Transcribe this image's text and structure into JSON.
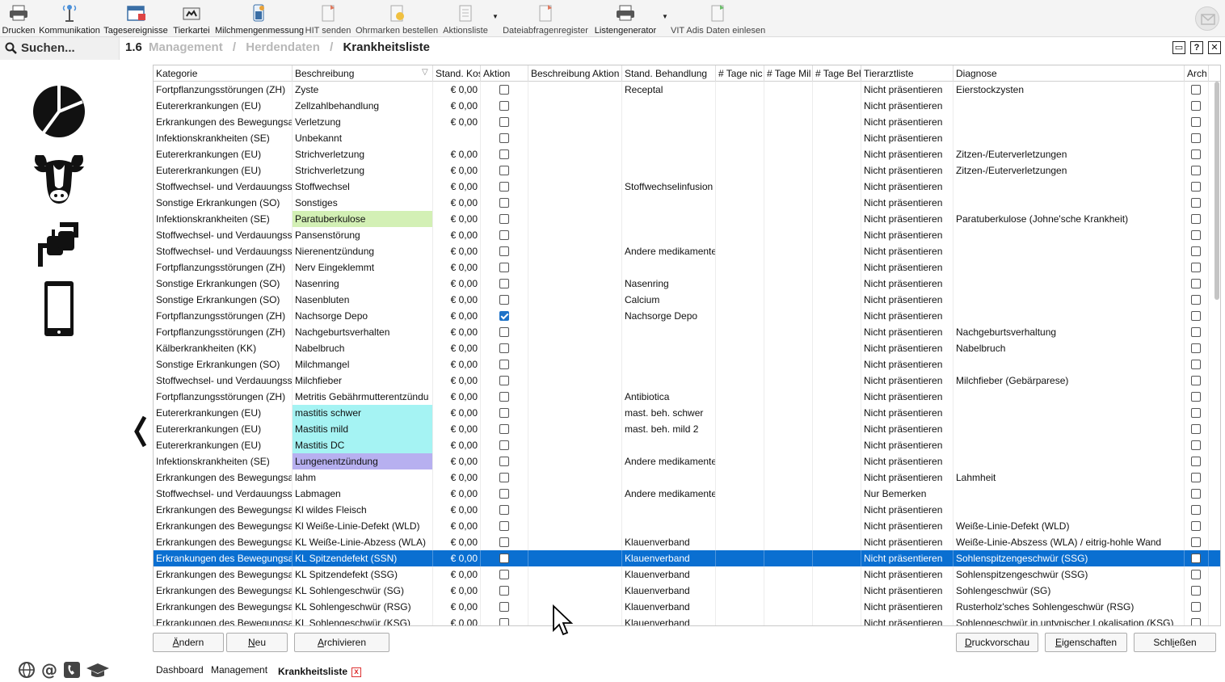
{
  "toolbar": {
    "items": [
      {
        "label": "Drucken",
        "icon": "printer-icon"
      },
      {
        "label": "Kommunikation",
        "icon": "antenna-icon"
      },
      {
        "label": "Tagesereignisse",
        "icon": "calendar-icon"
      },
      {
        "label": "Tierkartei",
        "icon": "card-file-icon"
      },
      {
        "label": "Milchmengenmessung",
        "icon": "milk-measure-icon"
      },
      {
        "label": "HIT senden",
        "icon": "document-send-icon"
      },
      {
        "label": "Ohrmarken bestellen",
        "icon": "ear-tag-order-icon"
      },
      {
        "label": "Aktionsliste",
        "icon": "list-document-icon"
      },
      {
        "label": "Dateiabfragenregister",
        "icon": "document-query-icon"
      },
      {
        "label": "Listengenerator",
        "icon": "printer-list-icon"
      },
      {
        "label": "VIT Adis Daten einlesen",
        "icon": "document-import-icon"
      }
    ]
  },
  "search": {
    "label": "Suchen..."
  },
  "breadcrumb": {
    "number": "1.6",
    "items": [
      "Management",
      "Herdendaten"
    ],
    "current": "Krankheitsliste"
  },
  "window_buttons": {
    "restore": "▭",
    "help": "?",
    "close": "✕"
  },
  "grid": {
    "columns": [
      "Kategorie",
      "Beschreibung",
      "Stand. Kos",
      "Aktion",
      "Beschreibung Aktion",
      "Stand. Behandlung",
      "# Tage nic",
      "# Tage Mil",
      "# Tage Beh",
      "Tierarztliste",
      "Diagnose",
      "Arch"
    ],
    "rows": [
      {
        "kategorie": "Fortpflanzungsstörungen (ZH)",
        "beschreibung": "Zyste",
        "kosten": "€ 0,00",
        "aktion": false,
        "behandlung": "Receptal",
        "tierarzt": "Nicht präsentieren",
        "diagnose": "Eierstockzysten",
        "hl": ""
      },
      {
        "kategorie": "Eutererkrankungen (EU)",
        "beschreibung": "Zellzahlbehandlung",
        "kosten": "€ 0,00",
        "aktion": false,
        "behandlung": "",
        "tierarzt": "Nicht präsentieren",
        "diagnose": "",
        "hl": ""
      },
      {
        "kategorie": "Erkrankungen des Bewegungsap",
        "beschreibung": "Verletzung",
        "kosten": "€ 0,00",
        "aktion": false,
        "behandlung": "",
        "tierarzt": "Nicht präsentieren",
        "diagnose": "",
        "hl": ""
      },
      {
        "kategorie": "Infektionskrankheiten (SE)",
        "beschreibung": "Unbekannt",
        "kosten": "",
        "aktion": false,
        "behandlung": "",
        "tierarzt": "Nicht präsentieren",
        "diagnose": "",
        "hl": ""
      },
      {
        "kategorie": "Eutererkrankungen (EU)",
        "beschreibung": "Strichverletzung",
        "kosten": "€ 0,00",
        "aktion": false,
        "behandlung": "",
        "tierarzt": "Nicht präsentieren",
        "diagnose": "Zitzen-/Euterverletzungen",
        "hl": ""
      },
      {
        "kategorie": "Eutererkrankungen (EU)",
        "beschreibung": "Strichverletzung",
        "kosten": "€ 0,00",
        "aktion": false,
        "behandlung": "",
        "tierarzt": "Nicht präsentieren",
        "diagnose": "Zitzen-/Euterverletzungen",
        "hl": ""
      },
      {
        "kategorie": "Stoffwechsel- und Verdauungss",
        "beschreibung": "Stoffwechsel",
        "kosten": "€ 0,00",
        "aktion": false,
        "behandlung": "Stoffwechselinfusion",
        "tierarzt": "Nicht präsentieren",
        "diagnose": "",
        "hl": ""
      },
      {
        "kategorie": "Sonstige Erkrankungen (SO)",
        "beschreibung": "Sonstiges",
        "kosten": "€ 0,00",
        "aktion": false,
        "behandlung": "",
        "tierarzt": "Nicht präsentieren",
        "diagnose": "",
        "hl": ""
      },
      {
        "kategorie": "Infektionskrankheiten (SE)",
        "beschreibung": "Paratuberkulose",
        "kosten": "€ 0,00",
        "aktion": false,
        "behandlung": "",
        "tierarzt": "Nicht präsentieren",
        "diagnose": "Paratuberkulose (Johne'sche Krankheit)",
        "hl": "#d3f0b5"
      },
      {
        "kategorie": "Stoffwechsel- und Verdauungss",
        "beschreibung": "Pansenstörung",
        "kosten": "€ 0,00",
        "aktion": false,
        "behandlung": "",
        "tierarzt": "Nicht präsentieren",
        "diagnose": "",
        "hl": ""
      },
      {
        "kategorie": "Stoffwechsel- und Verdauungss",
        "beschreibung": "Nierenentzündung",
        "kosten": "€ 0,00",
        "aktion": false,
        "behandlung": "Andere medikamente",
        "tierarzt": "Nicht präsentieren",
        "diagnose": "",
        "hl": ""
      },
      {
        "kategorie": "Fortpflanzungsstörungen (ZH)",
        "beschreibung": "Nerv Eingeklemmt",
        "kosten": "€ 0,00",
        "aktion": false,
        "behandlung": "",
        "tierarzt": "Nicht präsentieren",
        "diagnose": "",
        "hl": ""
      },
      {
        "kategorie": "Sonstige Erkrankungen (SO)",
        "beschreibung": "Nasenring",
        "kosten": "€ 0,00",
        "aktion": false,
        "behandlung": "Nasenring",
        "tierarzt": "Nicht präsentieren",
        "diagnose": "",
        "hl": ""
      },
      {
        "kategorie": "Sonstige Erkrankungen (SO)",
        "beschreibung": "Nasenbluten",
        "kosten": "€ 0,00",
        "aktion": false,
        "behandlung": "Calcium",
        "tierarzt": "Nicht präsentieren",
        "diagnose": "",
        "hl": ""
      },
      {
        "kategorie": "Fortpflanzungsstörungen (ZH)",
        "beschreibung": "Nachsorge Depo",
        "kosten": "€ 0,00",
        "aktion": true,
        "behandlung": "Nachsorge Depo",
        "tierarzt": "Nicht präsentieren",
        "diagnose": "",
        "hl": ""
      },
      {
        "kategorie": "Fortpflanzungsstörungen (ZH)",
        "beschreibung": "Nachgeburtsverhalten",
        "kosten": "€ 0,00",
        "aktion": false,
        "behandlung": "",
        "tierarzt": "Nicht präsentieren",
        "diagnose": "Nachgeburtsverhaltung",
        "hl": ""
      },
      {
        "kategorie": "Kälberkrankheiten (KK)",
        "beschreibung": "Nabelbruch",
        "kosten": "€ 0,00",
        "aktion": false,
        "behandlung": "",
        "tierarzt": "Nicht präsentieren",
        "diagnose": "Nabelbruch",
        "hl": ""
      },
      {
        "kategorie": "Sonstige Erkrankungen (SO)",
        "beschreibung": "Milchmangel",
        "kosten": "€ 0,00",
        "aktion": false,
        "behandlung": "",
        "tierarzt": "Nicht präsentieren",
        "diagnose": "",
        "hl": ""
      },
      {
        "kategorie": "Stoffwechsel- und Verdauungss",
        "beschreibung": "Milchfieber",
        "kosten": "€ 0,00",
        "aktion": false,
        "behandlung": "",
        "tierarzt": "Nicht präsentieren",
        "diagnose": "Milchfieber (Gebärparese)",
        "hl": ""
      },
      {
        "kategorie": "Fortpflanzungsstörungen (ZH)",
        "beschreibung": "Metritis Gebährmutterentzündu",
        "kosten": "€ 0,00",
        "aktion": false,
        "behandlung": "Antibiotica",
        "tierarzt": "Nicht präsentieren",
        "diagnose": "",
        "hl": ""
      },
      {
        "kategorie": "Eutererkrankungen (EU)",
        "beschreibung": "mastitis schwer",
        "kosten": "€ 0,00",
        "aktion": false,
        "behandlung": "mast. beh. schwer",
        "tierarzt": "Nicht präsentieren",
        "diagnose": "",
        "hl": "#a5f3f3"
      },
      {
        "kategorie": "Eutererkrankungen (EU)",
        "beschreibung": "Mastitis mild",
        "kosten": "€ 0,00",
        "aktion": false,
        "behandlung": "mast. beh. mild 2",
        "tierarzt": "Nicht präsentieren",
        "diagnose": "",
        "hl": "#a5f3f3"
      },
      {
        "kategorie": "Eutererkrankungen (EU)",
        "beschreibung": "Mastitis DC",
        "kosten": "€ 0,00",
        "aktion": false,
        "behandlung": "",
        "tierarzt": "Nicht präsentieren",
        "diagnose": "",
        "hl": "#a5f3f3"
      },
      {
        "kategorie": "Infektionskrankheiten (SE)",
        "beschreibung": "Lungenentzündung",
        "kosten": "€ 0,00",
        "aktion": false,
        "behandlung": "Andere medikamente",
        "tierarzt": "Nicht präsentieren",
        "diagnose": "",
        "hl": "#b7b0f0"
      },
      {
        "kategorie": "Erkrankungen des Bewegungsap",
        "beschreibung": "lahm",
        "kosten": "€ 0,00",
        "aktion": false,
        "behandlung": "",
        "tierarzt": "Nicht präsentieren",
        "diagnose": "Lahmheit",
        "hl": ""
      },
      {
        "kategorie": "Stoffwechsel- und Verdauungss",
        "beschreibung": "Labmagen",
        "kosten": "€ 0,00",
        "aktion": false,
        "behandlung": "Andere medikamente",
        "tierarzt": "Nur Bemerken",
        "diagnose": "",
        "hl": ""
      },
      {
        "kategorie": "Erkrankungen des Bewegungsap",
        "beschreibung": "Kl wildes Fleisch",
        "kosten": "€ 0,00",
        "aktion": false,
        "behandlung": "",
        "tierarzt": "Nicht präsentieren",
        "diagnose": "",
        "hl": ""
      },
      {
        "kategorie": "Erkrankungen des Bewegungsap",
        "beschreibung": "Kl Weiße-Linie-Defekt (WLD)",
        "kosten": "€ 0,00",
        "aktion": false,
        "behandlung": "",
        "tierarzt": "Nicht präsentieren",
        "diagnose": "Weiße-Linie-Defekt (WLD)",
        "hl": ""
      },
      {
        "kategorie": "Erkrankungen des Bewegungsap",
        "beschreibung": "KL Weiße-Linie-Abzess (WLA)",
        "kosten": "€ 0,00",
        "aktion": false,
        "behandlung": "Klauenverband",
        "tierarzt": "Nicht präsentieren",
        "diagnose": "Weiße-Linie-Abszess (WLA) / eitrig-hohle Wand",
        "hl": ""
      },
      {
        "kategorie": "Erkrankungen des Bewegungsap",
        "beschreibung": "KL Spitzendefekt (SSN)",
        "kosten": "€ 0,00",
        "aktion": false,
        "behandlung": "Klauenverband",
        "tierarzt": "Nicht präsentieren",
        "diagnose": "Sohlenspitzengeschwür (SSG)",
        "hl": "",
        "selected": true
      },
      {
        "kategorie": "Erkrankungen des Bewegungsap",
        "beschreibung": "KL Spitzendefekt (SSG)",
        "kosten": "€ 0,00",
        "aktion": false,
        "behandlung": "Klauenverband",
        "tierarzt": "Nicht präsentieren",
        "diagnose": "Sohlenspitzengeschwür (SSG)",
        "hl": ""
      },
      {
        "kategorie": "Erkrankungen des Bewegungsap",
        "beschreibung": "KL Sohlengeschwür (SG)",
        "kosten": "€ 0,00",
        "aktion": false,
        "behandlung": "Klauenverband",
        "tierarzt": "Nicht präsentieren",
        "diagnose": "Sohlengeschwür (SG)",
        "hl": ""
      },
      {
        "kategorie": "Erkrankungen des Bewegungsap",
        "beschreibung": "KL Sohlengeschwür (RSG)",
        "kosten": "€ 0,00",
        "aktion": false,
        "behandlung": "Klauenverband",
        "tierarzt": "Nicht präsentieren",
        "diagnose": "Rusterholz'sches Sohlengeschwür (RSG)",
        "hl": ""
      },
      {
        "kategorie": "Erkrankungen des Bewegungsap",
        "beschreibung": "KL Sohlengeschwür (KSG)",
        "kosten": "€ 0,00",
        "aktion": false,
        "behandlung": "Klauenverband",
        "tierarzt": "Nicht präsentieren",
        "diagnose": "Sohlengeschwür in untypischer Lokalisation (KSG)",
        "hl": ""
      }
    ]
  },
  "buttons": {
    "change": {
      "pre": "",
      "u": "Ä",
      "post": "ndern"
    },
    "new": {
      "pre": "",
      "u": "N",
      "post": "eu"
    },
    "archive": {
      "pre": "",
      "u": "A",
      "post": "rchivieren"
    },
    "print_preview": {
      "pre": "",
      "u": "D",
      "post": "ruckvorschau"
    },
    "properties": {
      "pre": "",
      "u": "E",
      "post": "igenschaften"
    },
    "close": {
      "pre": "Schl",
      "u": "i",
      "post": "eßen"
    }
  },
  "tabs": [
    "Dashboard",
    "Management",
    "Krankheitsliste"
  ],
  "tab_close": "x",
  "colors": {
    "selection": "#0a6fd1",
    "accent_red": "#d33"
  }
}
